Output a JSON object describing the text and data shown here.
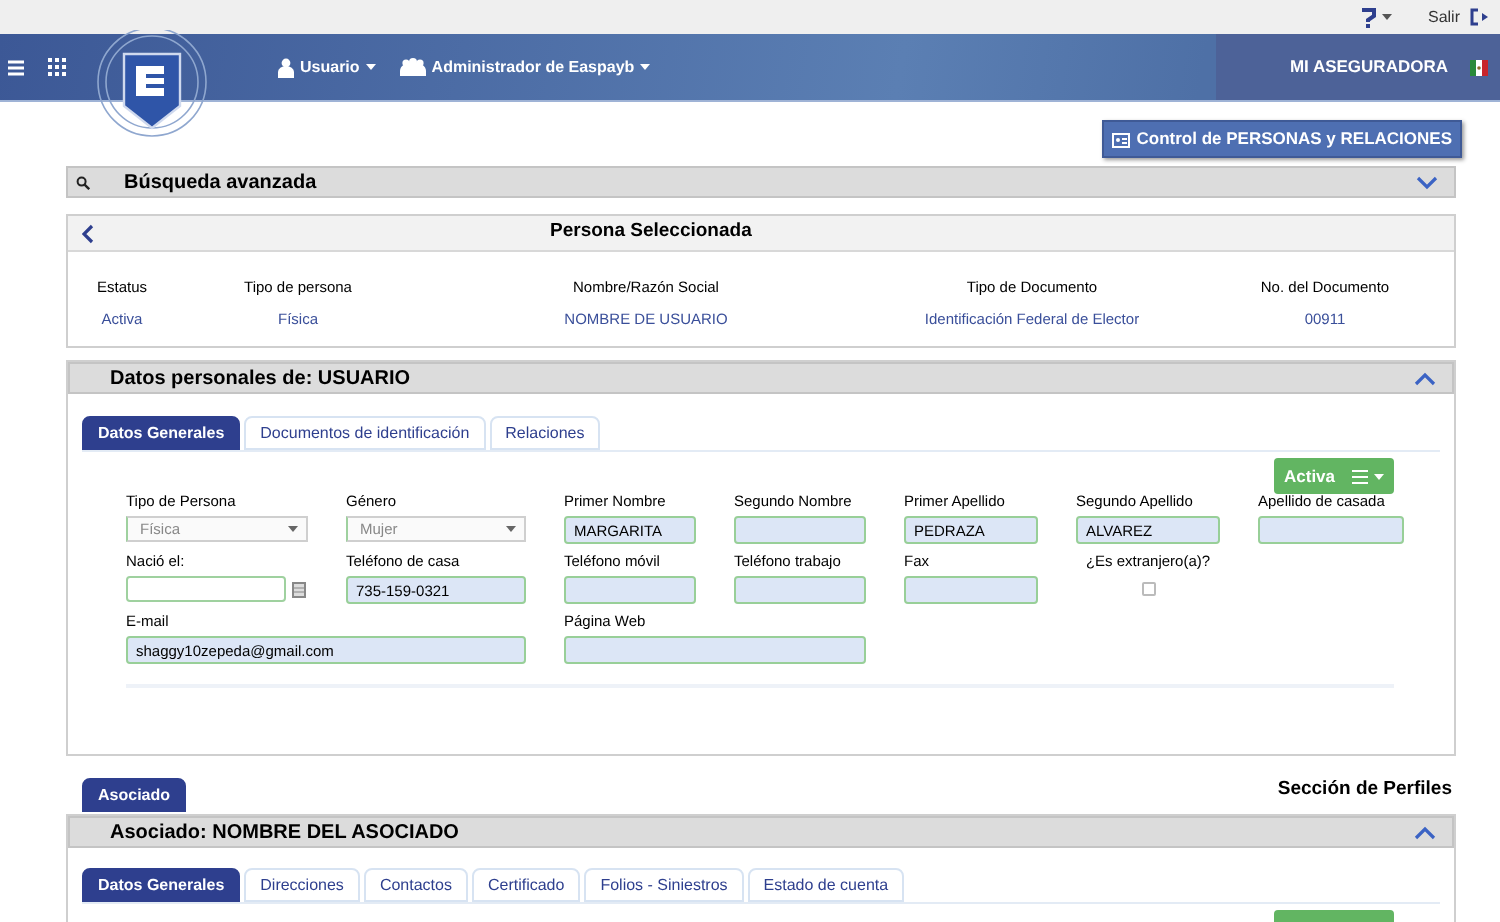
{
  "top_bar": {
    "logout": {
      "label": "Salir"
    }
  },
  "header": {
    "menus": [
      {
        "label": "Usuario",
        "kind": "user"
      },
      {
        "label": "Administrador de Easpayb",
        "kind": "group"
      }
    ],
    "company": "MI ASEGURADORA"
  },
  "control_button": {
    "label": "Control de PERSONAS y RELACIONES"
  },
  "advanced_search": {
    "title": "Búsqueda avanzada",
    "expanded": false
  },
  "selected_person": {
    "title": "Persona Seleccionada",
    "columns": [
      {
        "label": "Estatus",
        "value": "Activa"
      },
      {
        "label": "Tipo de persona",
        "value": "Física"
      },
      {
        "label": "Nombre/Razón Social",
        "value": "NOMBRE DE USUARIO"
      },
      {
        "label": "Tipo de Documento",
        "value": "Identificación Federal de Elector"
      },
      {
        "label": "No. del Documento",
        "value": "00911"
      }
    ]
  },
  "personal_data": {
    "title": "Datos personales de: USUARIO",
    "expanded": true,
    "tabs": [
      {
        "label": "Datos Generales",
        "selected": true
      },
      {
        "label": "Documentos de identificación",
        "selected": false
      },
      {
        "label": "Relaciones",
        "selected": false
      }
    ],
    "status_button": {
      "label": "Activa"
    },
    "fields": [
      {
        "kind": "select",
        "label": "Tipo de Persona",
        "value": "Física",
        "disabled": true
      },
      {
        "kind": "select",
        "label": "Género",
        "value": "Mujer",
        "disabled": true
      },
      {
        "kind": "text",
        "label": "Primer Nombre",
        "value": "MARGARITA"
      },
      {
        "kind": "text",
        "label": "Segundo Nombre"
      },
      {
        "kind": "text",
        "label": "Primer Apellido",
        "value": "PEDRAZA"
      },
      {
        "kind": "text",
        "label": "Segundo Apellido",
        "value": "ALVAREZ"
      },
      {
        "kind": "text",
        "label": "Apellido de casada"
      },
      {
        "kind": "date",
        "label": "Nació el:"
      },
      {
        "kind": "text",
        "label": "Teléfono de casa",
        "value": "735-159-0321"
      },
      {
        "kind": "text",
        "label": "Teléfono móvil"
      },
      {
        "kind": "text",
        "label": "Teléfono trabajo"
      },
      {
        "kind": "text",
        "label": "Fax"
      },
      {
        "kind": "checkbox",
        "label": "¿Es extranjero(a)?",
        "checked": false
      },
      {
        "kind": "long_text",
        "label": "E-mail",
        "value": "shaggy10zepeda@gmail.com"
      },
      {
        "kind": "long_text",
        "label": "Página Web"
      }
    ]
  },
  "profiles": {
    "tabs": [
      {
        "label": "Asociado",
        "selected": true
      }
    ],
    "title": "Sección de Perfiles"
  },
  "associate": {
    "title": "Asociado: NOMBRE DEL ASOCIADO",
    "expanded": true,
    "tabs": [
      {
        "label": "Datos Generales",
        "selected": true
      },
      {
        "label": "Direcciones",
        "selected": false
      },
      {
        "label": "Contactos",
        "selected": false
      },
      {
        "label": "Certificado",
        "selected": false
      },
      {
        "label": "Folios - Siniestros",
        "selected": false
      },
      {
        "label": "Estado de cuenta",
        "selected": false
      }
    ]
  }
}
